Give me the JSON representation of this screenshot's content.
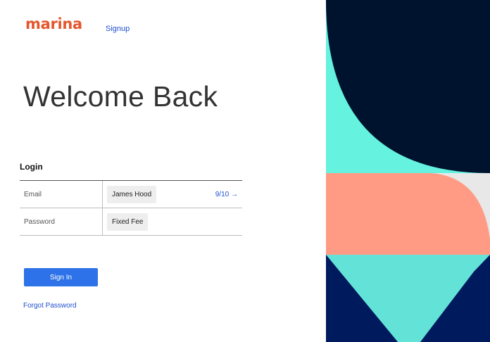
{
  "brand": {
    "logo_text": "marina",
    "logo_color": "#e4572e"
  },
  "nav": {
    "signup_label": "Signup"
  },
  "heading": {
    "title": "Welcome Back"
  },
  "login": {
    "section_label": "Login",
    "rows": [
      {
        "label": "Email",
        "value": "James Hood",
        "pager": "9/10 →"
      },
      {
        "label": "Password",
        "value": "Fixed Fee"
      }
    ],
    "signin_label": "Sign In",
    "forgot_label": "Forgot Password"
  },
  "colors": {
    "accent": "#2d72e8",
    "link": "#1f4fd1",
    "art_navy": "#00132e",
    "art_turquoise": "#65f2df",
    "art_salmon": "#ff9b85",
    "art_light": "#e8e8e8",
    "art_blue": "#001a5e",
    "art_teal": "#63e3d8"
  }
}
